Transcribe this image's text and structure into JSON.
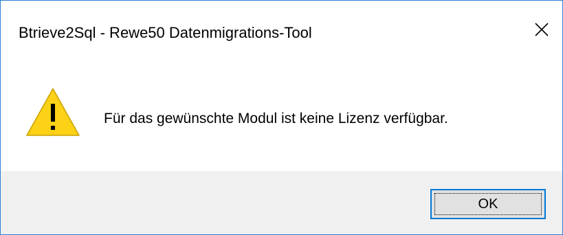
{
  "window": {
    "title": "Btrieve2Sql - Rewe50 Datenmigrations-Tool",
    "close_icon": "close-icon"
  },
  "dialog": {
    "icon": "warning-icon",
    "message": "Für das gewünschte Modul ist keine Lizenz verfügbar.",
    "ok_label": "OK"
  },
  "colors": {
    "border": "#2b7fd6",
    "footer_bg": "#f0f0f0",
    "button_bg": "#e1e1e1",
    "button_border": "#0078d7",
    "warning_fill": "#fcd116"
  }
}
